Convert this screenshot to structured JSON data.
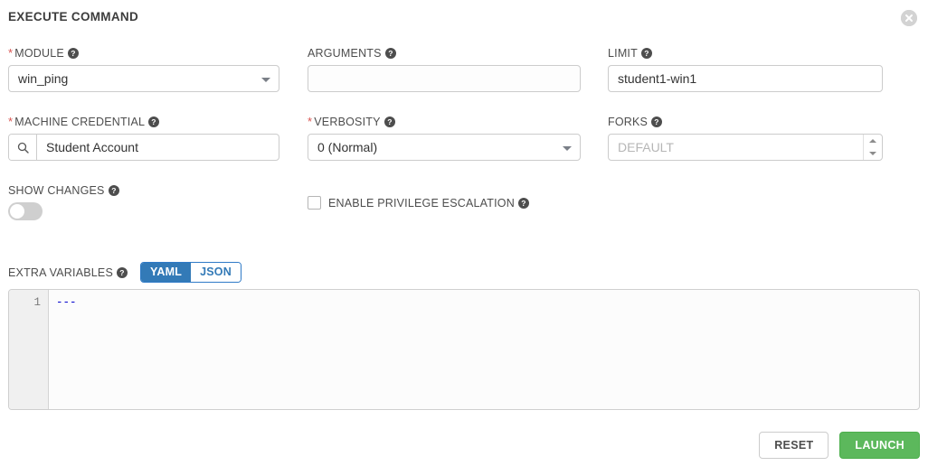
{
  "header": {
    "title": "EXECUTE COMMAND",
    "close_icon": "close-circle-icon"
  },
  "fields": {
    "module": {
      "label": "MODULE",
      "required": true,
      "value": "win_ping",
      "help_icon": "question-circle-icon",
      "caret_icon": "chevron-down-icon"
    },
    "arguments": {
      "label": "ARGUMENTS",
      "required": false,
      "value": "",
      "placeholder": "",
      "help_icon": "question-circle-icon"
    },
    "limit": {
      "label": "LIMIT",
      "required": false,
      "value": "student1-win1",
      "help_icon": "question-circle-icon"
    },
    "machine_credential": {
      "label": "MACHINE CREDENTIAL",
      "required": true,
      "value": "Student Account",
      "search_icon": "magnifier-icon",
      "help_icon": "question-circle-icon"
    },
    "verbosity": {
      "label": "VERBOSITY",
      "required": true,
      "value": "0 (Normal)",
      "help_icon": "question-circle-icon",
      "caret_icon": "chevron-down-icon"
    },
    "forks": {
      "label": "FORKS",
      "required": false,
      "value": "",
      "placeholder": "DEFAULT",
      "help_icon": "question-circle-icon",
      "spinner_up_icon": "chevron-up-icon",
      "spinner_down_icon": "chevron-down-icon"
    },
    "show_changes": {
      "label": "SHOW CHANGES",
      "state": "off",
      "help_icon": "question-circle-icon"
    },
    "enable_privilege_escalation": {
      "label": "ENABLE PRIVILEGE ESCALATION",
      "checked": false,
      "help_icon": "question-circle-icon"
    }
  },
  "extra_variables": {
    "label": "EXTRA VARIABLES",
    "help_icon": "question-circle-icon",
    "format_options": [
      {
        "label": "YAML",
        "active": true
      },
      {
        "label": "JSON",
        "active": false
      }
    ],
    "line_numbers": [
      "1"
    ],
    "lines": [
      "---"
    ]
  },
  "footer": {
    "reset_label": "RESET",
    "launch_label": "LAUNCH"
  },
  "colors": {
    "accent_blue": "#337ab7",
    "launch_green": "#5cb85c",
    "required_red": "#d9534f",
    "code_blue": "#0000cc"
  }
}
